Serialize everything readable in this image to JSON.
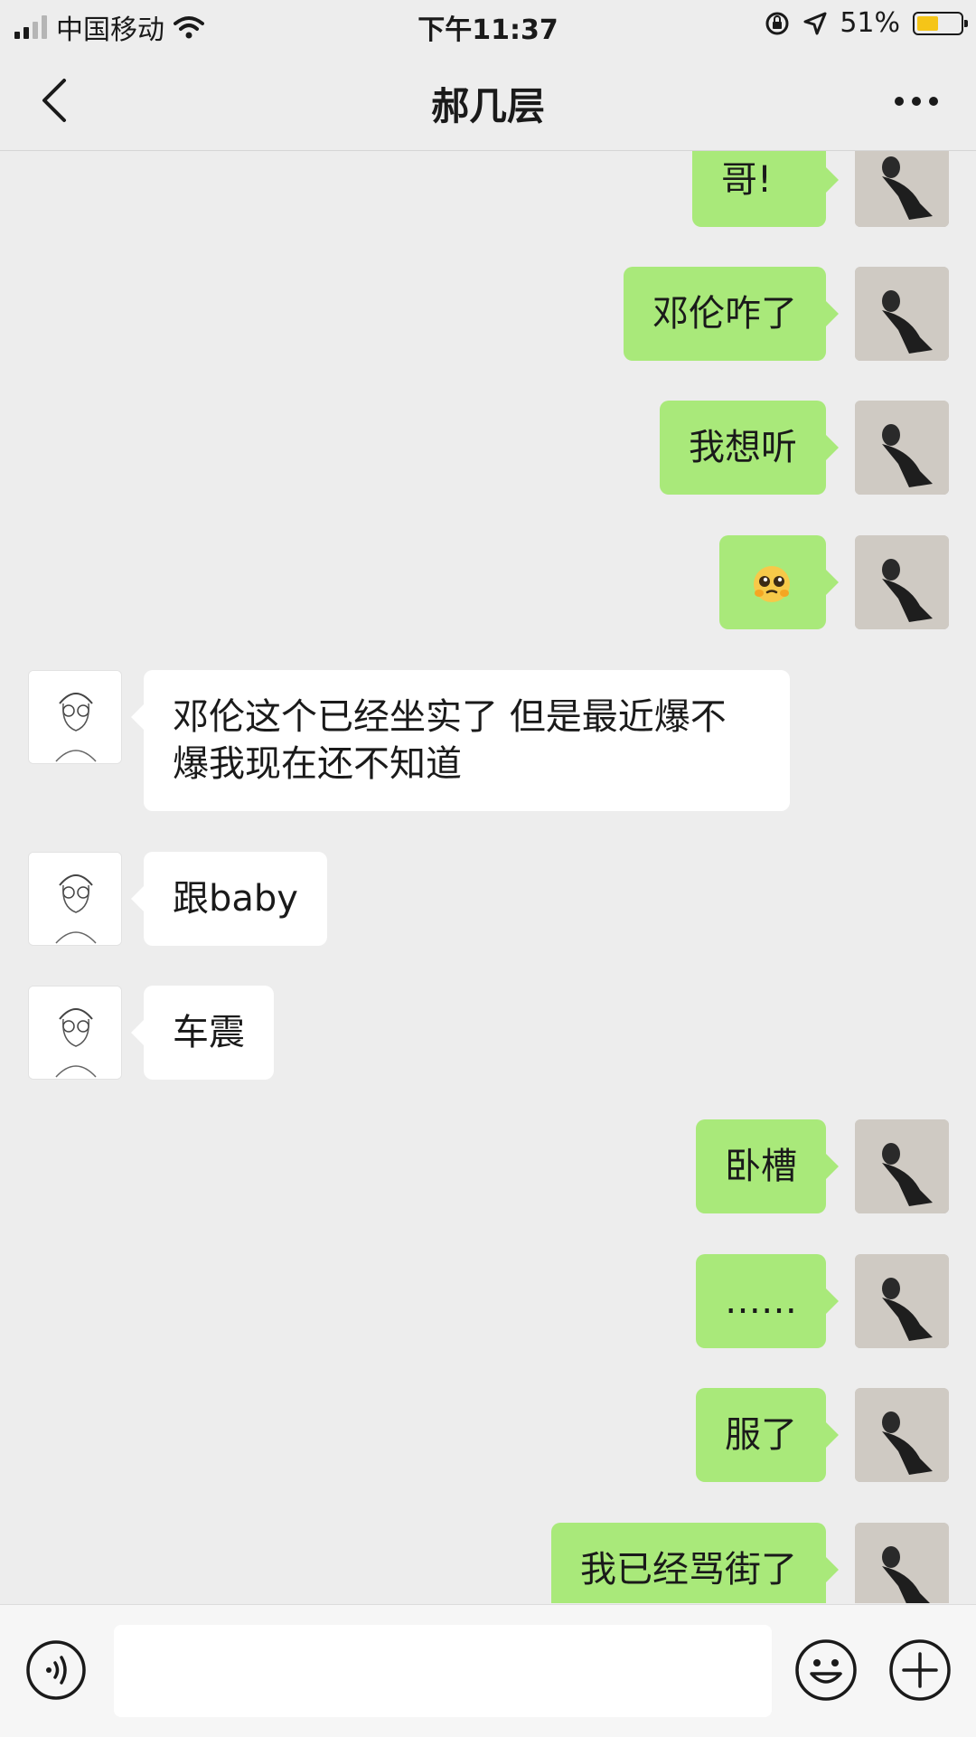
{
  "status_bar": {
    "carrier": "中国移动",
    "time": "下午11:37",
    "battery_percent": "51%",
    "battery_level": 0.51,
    "battery_color": "#f5c518"
  },
  "nav": {
    "back_icon": "chevron-left-icon",
    "title": "郝几层",
    "more_icon": "more-dots-icon"
  },
  "messages": [
    {
      "side": "out",
      "text": "哥!"
    },
    {
      "side": "out",
      "text": "邓伦咋了"
    },
    {
      "side": "out",
      "text": "我想听"
    },
    {
      "side": "out",
      "emoji": "pleading-face-emoji"
    },
    {
      "side": "in",
      "text": "邓伦这个已经坐实了 但是最近爆不爆我现在还不知道"
    },
    {
      "side": "in",
      "text": "跟baby"
    },
    {
      "side": "in",
      "text": "车震"
    },
    {
      "side": "out",
      "text": "卧槽"
    },
    {
      "side": "out",
      "text": "……"
    },
    {
      "side": "out",
      "text": "服了"
    },
    {
      "side": "out",
      "text": "我已经骂街了"
    }
  ],
  "colors": {
    "out_bubble": "#a9e97a",
    "in_bubble": "#ffffff",
    "background": "#ededed"
  },
  "input_bar": {
    "voice_icon": "voice-icon",
    "emoji_icon": "emoji-icon",
    "plus_icon": "plus-icon",
    "input_value": ""
  }
}
